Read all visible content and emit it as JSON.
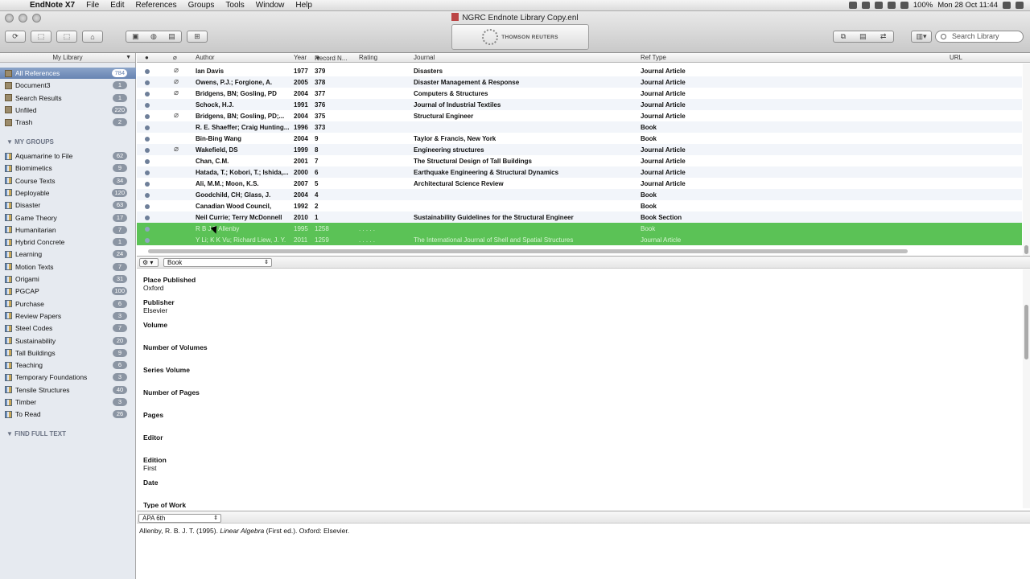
{
  "menubar": {
    "app": "EndNote X7",
    "items": [
      "File",
      "Edit",
      "References",
      "Groups",
      "Tools",
      "Window",
      "Help"
    ],
    "battery": "100%",
    "clock": "Mon 28 Oct  11:44"
  },
  "window": {
    "title": "NGRC Endnote Library Copy.enl"
  },
  "logo": {
    "text": "THOMSON REUTERS"
  },
  "search": {
    "placeholder": "Search Library"
  },
  "sidebar": {
    "header": "My Library",
    "library": [
      {
        "label": "All References",
        "count": "784",
        "icon": "library-icon"
      },
      {
        "label": "Document3",
        "count": "1",
        "icon": "document-icon"
      },
      {
        "label": "Search Results",
        "count": "1",
        "icon": "search-results-icon"
      },
      {
        "label": "Unfiled",
        "count": "220",
        "icon": "unfiled-icon"
      },
      {
        "label": "Trash",
        "count": "2",
        "icon": "trash-icon"
      }
    ],
    "groups_header": "MY GROUPS",
    "groups": [
      {
        "label": "Aquamarine to File",
        "count": "62"
      },
      {
        "label": "Biomimetics",
        "count": "9"
      },
      {
        "label": "Course Texts",
        "count": "34"
      },
      {
        "label": "Deployable",
        "count": "120"
      },
      {
        "label": "Disaster",
        "count": "63"
      },
      {
        "label": "Game Theory",
        "count": "17"
      },
      {
        "label": "Humanitarian",
        "count": "7"
      },
      {
        "label": "Hybrid Concrete",
        "count": "1"
      },
      {
        "label": "Learning",
        "count": "24"
      },
      {
        "label": "Motion Texts",
        "count": "7"
      },
      {
        "label": "Origami",
        "count": "31"
      },
      {
        "label": "PGCAP",
        "count": "100"
      },
      {
        "label": "Purchase",
        "count": "6"
      },
      {
        "label": "Review Papers",
        "count": "3"
      },
      {
        "label": "Steel Codes",
        "count": "7"
      },
      {
        "label": "Sustainability",
        "count": "20"
      },
      {
        "label": "Tall Buildings",
        "count": "9"
      },
      {
        "label": "Teaching",
        "count": "6"
      },
      {
        "label": "Temporary Foundations",
        "count": "3"
      },
      {
        "label": "Tensile Structures",
        "count": "40"
      },
      {
        "label": "Timber",
        "count": "3"
      },
      {
        "label": "To Read",
        "count": "26"
      }
    ],
    "find_full_text": "FIND FULL TEXT"
  },
  "columns": {
    "author": "Author",
    "year": "Year",
    "record": "Record N...",
    "rating": "Rating",
    "journal": "Journal",
    "reftype": "Ref Type",
    "url": "URL"
  },
  "references": [
    {
      "author": "Ian Davis",
      "year": "1977",
      "record": "379",
      "journal": "Disasters",
      "reftype": "Journal Article",
      "clip": true
    },
    {
      "author": "Owens, P.J.; Forgione, A.",
      "year": "2005",
      "record": "378",
      "journal": "Disaster Management & Response",
      "reftype": "Journal Article",
      "clip": true
    },
    {
      "author": "Bridgens, BN; Gosling, PD",
      "year": "2004",
      "record": "377",
      "journal": "Computers & Structures",
      "reftype": "Journal Article",
      "clip": true
    },
    {
      "author": "Schock, H.J.",
      "year": "1991",
      "record": "376",
      "journal": "Journal of Industrial Textiles",
      "reftype": "Journal Article",
      "clip": false
    },
    {
      "author": "Bridgens, BN; Gosling, PD;...",
      "year": "2004",
      "record": "375",
      "journal": "Structural Engineer",
      "reftype": "Journal Article",
      "clip": true
    },
    {
      "author": "R. E. Shaeffer; Craig Hunting...",
      "year": "1996",
      "record": "373",
      "journal": "",
      "reftype": "Book",
      "clip": false
    },
    {
      "author": "Bin-Bing Wang",
      "year": "2004",
      "record": "9",
      "journal": "Taylor & Francis, New York",
      "reftype": "Book",
      "clip": false
    },
    {
      "author": "Wakefield, DS",
      "year": "1999",
      "record": "8",
      "journal": "Engineering structures",
      "reftype": "Journal Article",
      "clip": true
    },
    {
      "author": "Chan, C.M.",
      "year": "2001",
      "record": "7",
      "journal": "The Structural Design of Tall Buildings",
      "reftype": "Journal Article",
      "clip": false
    },
    {
      "author": "Hatada, T.; Kobori, T.; Ishida,...",
      "year": "2000",
      "record": "6",
      "journal": "Earthquake Engineering & Structural Dynamics",
      "reftype": "Journal Article",
      "clip": false
    },
    {
      "author": "Ali, M.M.; Moon, K.S.",
      "year": "2007",
      "record": "5",
      "journal": "Architectural Science Review",
      "reftype": "Journal Article",
      "clip": false
    },
    {
      "author": "Goodchild, CH; Glass, J.",
      "year": "2004",
      "record": "4",
      "journal": "",
      "reftype": "Book",
      "clip": false
    },
    {
      "author": "Canadian Wood Council,",
      "year": "1992",
      "record": "2",
      "journal": "",
      "reftype": "Book",
      "clip": false
    },
    {
      "author": "Neil Currie; Terry McDonnell",
      "year": "2010",
      "record": "1",
      "journal": "Sustainability Guidelines for the Structural Engineer",
      "reftype": "Book Section",
      "clip": false
    },
    {
      "author": "R B J T Allenby",
      "year": "1995",
      "record": "1258",
      "journal": "",
      "reftype": "Book",
      "clip": false,
      "selected": true,
      "rating": ". . . . ."
    },
    {
      "author": "Y Li; K K Vu; Richard Liew, J. Y.",
      "year": "2011",
      "record": "1259",
      "journal": "The International Journal of Shell and Spatial Structures",
      "reftype": "Journal Article",
      "clip": false,
      "selected": true,
      "rating": ". . . . ."
    }
  ],
  "editor": {
    "gear": "⚙ ▾",
    "ref_type": "Book",
    "fields": [
      {
        "label": "Place Published",
        "value": "Oxford"
      },
      {
        "label": "Publisher",
        "value": "Elsevier"
      },
      {
        "label": "Volume",
        "value": ""
      },
      {
        "label": "Number of Volumes",
        "value": ""
      },
      {
        "label": "Series Volume",
        "value": ""
      },
      {
        "label": "Number of Pages",
        "value": ""
      },
      {
        "label": "Pages",
        "value": ""
      },
      {
        "label": "Editor",
        "value": ""
      },
      {
        "label": "Edition",
        "value": "First"
      },
      {
        "label": "Date",
        "value": ""
      },
      {
        "label": "Type of Work",
        "value": ""
      }
    ]
  },
  "preview": {
    "style": "APA 6th",
    "citation_pre": "Allenby, R. B. J. T. (1995). ",
    "citation_title": "Linear Algebra",
    "citation_post": " (First ed.). Oxford: Elsevier."
  }
}
